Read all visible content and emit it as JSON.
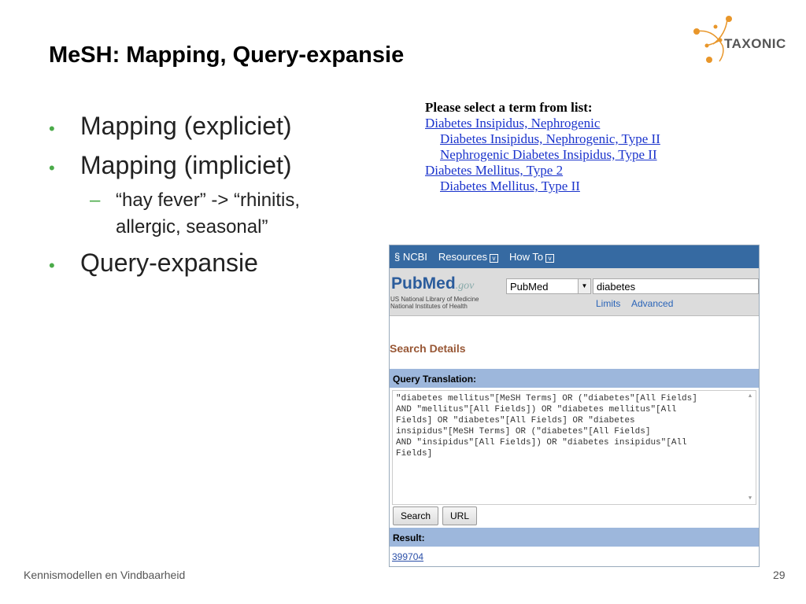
{
  "title": "MeSH: Mapping, Query-expansie",
  "logo": {
    "text": "TAXONIC",
    "color": "#e8962a"
  },
  "bullets": [
    {
      "label": "Mapping (expliciet)"
    },
    {
      "label": "Mapping (impliciet)"
    },
    {
      "label": "Query-expansie"
    }
  ],
  "sub_bullet": {
    "line1": "“hay fever” -> “rhinitis,",
    "line2": "allergic, seasonal”"
  },
  "term_list": {
    "heading": "Please select a term from list:",
    "items": [
      "Diabetes Insipidus, Nephrogenic",
      "Diabetes Insipidus, Nephrogenic, Type II",
      "Nephrogenic Diabetes Insipidus, Type II",
      "Diabetes Mellitus, Type 2",
      "Diabetes Mellitus, Type II"
    ]
  },
  "pubmed": {
    "ncbi": "NCBI",
    "resources": "Resources",
    "howto": "How To",
    "logo": "PubMed",
    "logo_suffix": ".gov",
    "nlm1": "US National Library of Medicine",
    "nlm2": "National Institutes of Health",
    "db_select": "PubMed",
    "search_value": "diabetes",
    "limits": "Limits",
    "advanced": "Advanced",
    "search_details": "Search Details",
    "query_translation_label": "Query Translation:",
    "query_translation": "\"diabetes mellitus\"[MeSH Terms] OR (\"diabetes\"[All Fields]\nAND \"mellitus\"[All Fields]) OR \"diabetes mellitus\"[All\nFields] OR \"diabetes\"[All Fields] OR \"diabetes\ninsipidus\"[MeSH Terms] OR (\"diabetes\"[All Fields]\nAND \"insipidus\"[All Fields]) OR \"diabetes insipidus\"[All\nFields]",
    "search_btn": "Search",
    "url_btn": "URL",
    "result_label": "Result:",
    "result_count": "399704"
  },
  "footer": {
    "left": "Kennismodellen en Vindbaarheid",
    "page": "29"
  }
}
